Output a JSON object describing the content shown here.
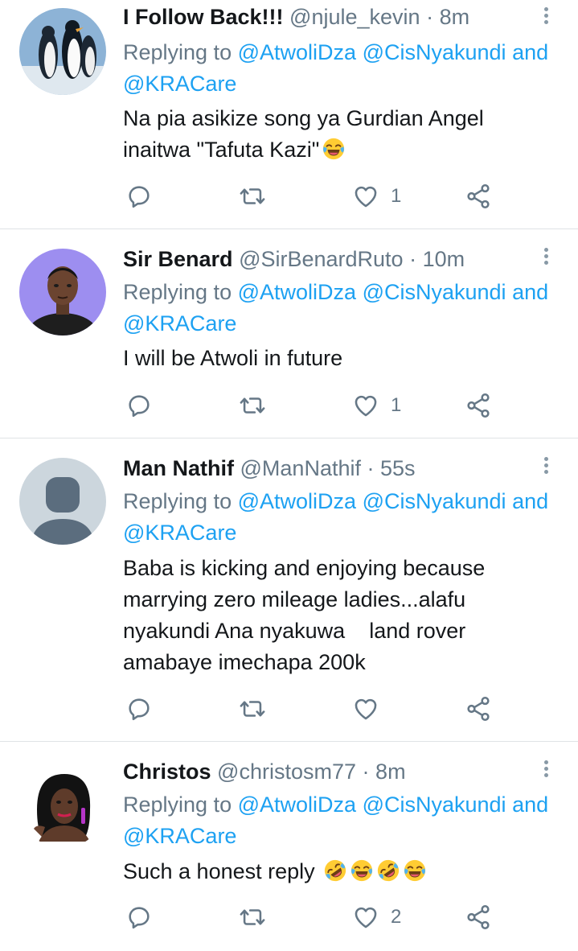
{
  "colors": {
    "link": "#1da1f2",
    "secondary_text": "#657786",
    "primary_text": "#14171a",
    "divider": "#dfe3e6"
  },
  "tweets": [
    {
      "name": "I Follow Back!!!",
      "handle": "@njule_kevin",
      "separator": "·",
      "time": "8m",
      "replying_prefix": "Replying to",
      "mention_1": "@AtwoliDza",
      "mention_2": "@CisNyakundi",
      "and": "and",
      "mention_3": "@KRACare",
      "text": "Na pia asikize song ya Gurdian Angel inaitwa \"Tafuta Kazi\"",
      "emojis": [
        "face-with-tears-of-joy"
      ],
      "like_count": "1",
      "avatar": "penguins-avatar"
    },
    {
      "name": "Sir Benard",
      "handle": "@SirBenardRuto",
      "separator": "·",
      "time": "10m",
      "replying_prefix": "Replying to",
      "mention_1": "@AtwoliDza",
      "mention_2": "@CisNyakundi",
      "and": "and",
      "mention_3": "@KRACare",
      "text": "I will be Atwoli in future",
      "like_count": "1",
      "avatar": "man-portrait-avatar"
    },
    {
      "name": "Man Nathif",
      "handle": "@ManNathif",
      "separator": "·",
      "time": "55s",
      "replying_prefix": "Replying to",
      "mention_1": "@AtwoliDza",
      "mention_2": "@CisNyakundi",
      "and": "and",
      "mention_3": "@KRACare",
      "text": "Baba is kicking and enjoying because marrying zero mileage ladies...alafu nyakundi Ana nyakuwa    land rover amabaye imechapa 200k",
      "like_count": "",
      "avatar": "default-avatar"
    },
    {
      "name": "Christos",
      "handle": "@christosm77",
      "separator": "·",
      "time": "8m",
      "replying_prefix": "Replying to",
      "mention_1": "@AtwoliDza",
      "mention_2": "@CisNyakundi",
      "and": "and",
      "mention_3": "@KRACare",
      "text": "Such a honest reply",
      "emojis": [
        "rolling-on-floor-laughing",
        "face-with-tears-of-joy",
        "rolling-on-floor-laughing",
        "face-with-tears-of-joy"
      ],
      "like_count": "2",
      "avatar": "woman-portrait-avatar"
    }
  ]
}
